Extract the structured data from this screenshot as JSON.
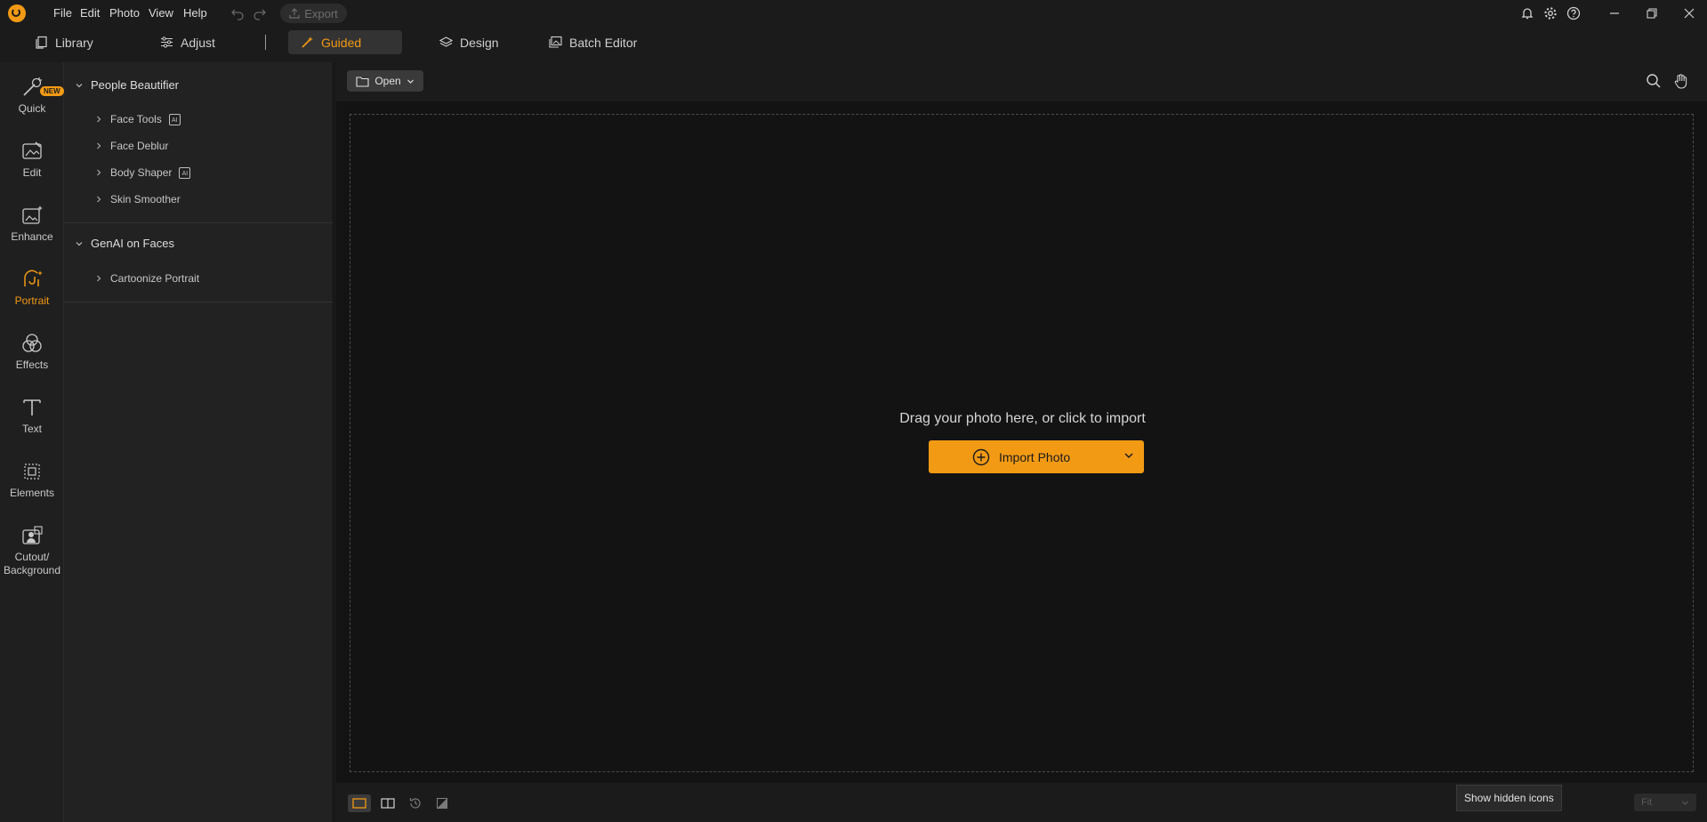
{
  "menu": {
    "items": [
      "File",
      "Edit",
      "Photo",
      "View",
      "Help"
    ],
    "export_label": "Export"
  },
  "modes": [
    {
      "label": "Library",
      "icon": "library-icon"
    },
    {
      "label": "Adjust",
      "icon": "sliders-icon"
    },
    {
      "label": "Guided",
      "icon": "magic-wand-icon",
      "active": true
    },
    {
      "label": "Design",
      "icon": "layers-icon"
    },
    {
      "label": "Batch Editor",
      "icon": "batch-icon"
    }
  ],
  "rail": [
    {
      "label": "Quick",
      "icon": "quick-wand-icon",
      "badge": "NEW"
    },
    {
      "label": "Edit",
      "icon": "edit-image-icon"
    },
    {
      "label": "Enhance",
      "icon": "enhance-image-icon"
    },
    {
      "label": "Portrait",
      "icon": "portrait-icon",
      "active": true
    },
    {
      "label": "Effects",
      "icon": "effects-icon"
    },
    {
      "label": "Text",
      "icon": "text-icon"
    },
    {
      "label": "Elements",
      "icon": "elements-icon"
    },
    {
      "label": "Cutout/",
      "label2": "Background",
      "icon": "cutout-icon"
    }
  ],
  "panel": {
    "sections": [
      {
        "title": "People Beautifier",
        "items": [
          {
            "label": "Face Tools",
            "ai": true
          },
          {
            "label": "Face Deblur",
            "ai": false
          },
          {
            "label": "Body Shaper",
            "ai": true
          },
          {
            "label": "Skin Smoother",
            "ai": false
          }
        ]
      },
      {
        "title": "GenAI on Faces",
        "items": [
          {
            "label": "Cartoonize Portrait",
            "ai": false
          }
        ]
      }
    ],
    "ai_badge": "AI"
  },
  "toolbar": {
    "open_label": "Open"
  },
  "canvas": {
    "drop_text": "Drag your photo here, or click to import",
    "import_label": "Import Photo"
  },
  "bottom": {
    "tooltip": "Show hidden icons",
    "zoom_label": "Fit"
  },
  "colors": {
    "accent": "#f39a14",
    "background": "#131313"
  }
}
